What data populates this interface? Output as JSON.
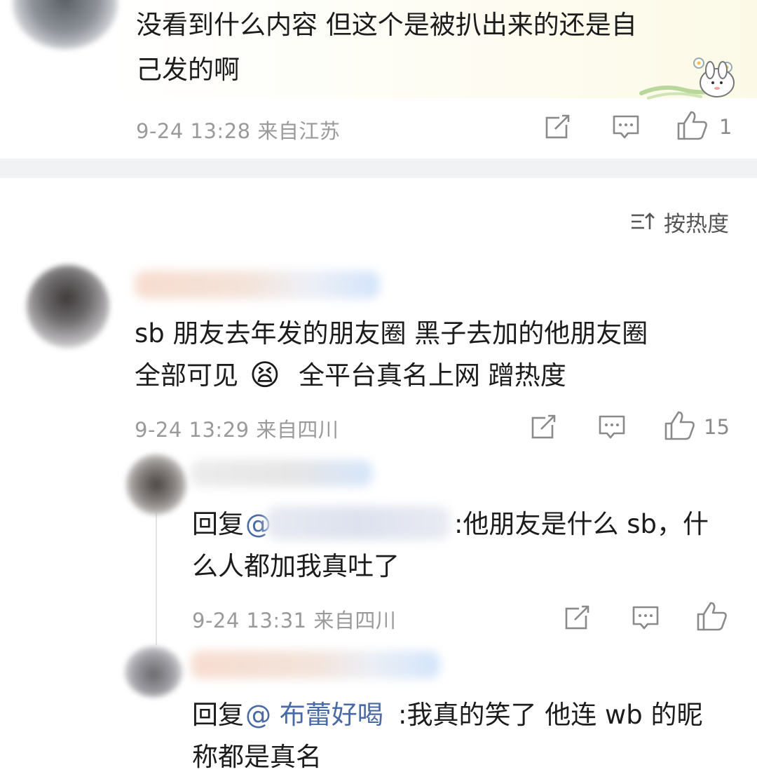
{
  "comments": [
    {
      "lines": [
        "没看到什么内容 但这个是被扒出来的还是自",
        "己发的啊"
      ],
      "meta": "9-24 13:28 来自江苏",
      "likes": "1"
    },
    {
      "lines": [
        "sb 朋友去年发的朋友圈 黑子去加的他朋友圈",
        "全部可见",
        "全平台真名上网 蹭热度"
      ],
      "meta": "9-24 13:29 来自四川",
      "likes": "15",
      "emoji": "😫"
    }
  ],
  "sort": {
    "label": "按热度"
  },
  "replies": [
    {
      "prefix": "回复",
      "mention": "@",
      "text_line1": ":他朋友是什么 sb，什",
      "text_line2": "么人都加我真吐了",
      "meta": "9-24 13:31 来自四川"
    },
    {
      "prefix": "回复",
      "mention": "@ 布蕾好喝",
      "text_line1": ":我真的笑了 他连 wb 的昵",
      "text_line2": "称都是真名"
    }
  ],
  "icons": {
    "share": "share-icon",
    "comment": "comment-icon",
    "like": "thumbs-up-icon",
    "sort": "sort-icon"
  },
  "colors": {
    "mention": "#4a6aa5",
    "meta": "#9a9a9a",
    "divider": "#f1f2f3"
  }
}
